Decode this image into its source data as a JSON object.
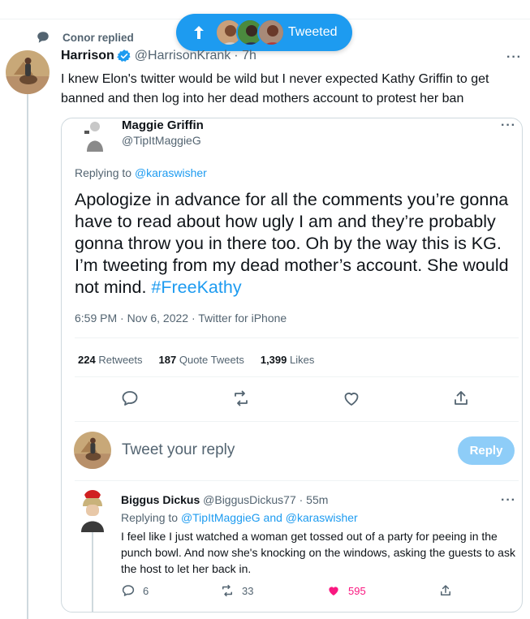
{
  "pill": {
    "label": "Tweeted",
    "icon": "arrow-up-icon"
  },
  "context": {
    "label": "Conor replied",
    "icon": "speech-bubble-icon"
  },
  "main_tweet": {
    "name": "Harrison",
    "handle": "@HarrisonKrank",
    "time": "· 7h",
    "text": "I knew Elon's twitter would be wild but I never expected Kathy Griffin to get banned and then log into her dead mothers account to protest her ban"
  },
  "quoted": {
    "name": "Maggie Griffin",
    "handle": "@TipItMaggieG",
    "replying_prefix": "Replying to",
    "replying_to": "@karaswisher",
    "text": "Apologize in advance for all the comments you’re gonna have to read about how ugly I am and they’re probably gonna throw you in there too. Oh by the way this is KG. I’m tweeting from my dead mother’s account. She would not mind.",
    "hashtag": "#FreeKathy",
    "timestamp": "6:59 PM · Nov 6, 2022 · Twitter for iPhone",
    "stats": {
      "retweets_count": "224",
      "retweets_label": "Retweets",
      "quotes_count": "187",
      "quotes_label": "Quote Tweets",
      "likes_count": "1,399",
      "likes_label": "Likes"
    }
  },
  "composer": {
    "placeholder": "Tweet your reply",
    "button": "Reply"
  },
  "reply": {
    "name": "Biggus Dickus",
    "handle": "@BiggusDickus77 · 55m",
    "replying_prefix": "Replying to",
    "replying_to": "@TipItMaggieG and @karaswisher",
    "text": "I feel like I just watched a woman get tossed out of a party for peeing in the punch bowl.  And now she's knocking on the windows, asking the guests to ask the host to let her back in.",
    "replies": "6",
    "retweets": "33",
    "likes": "595"
  },
  "colors": {
    "accent": "#1d9bf0",
    "like": "#f91880",
    "muted": "#536471"
  }
}
